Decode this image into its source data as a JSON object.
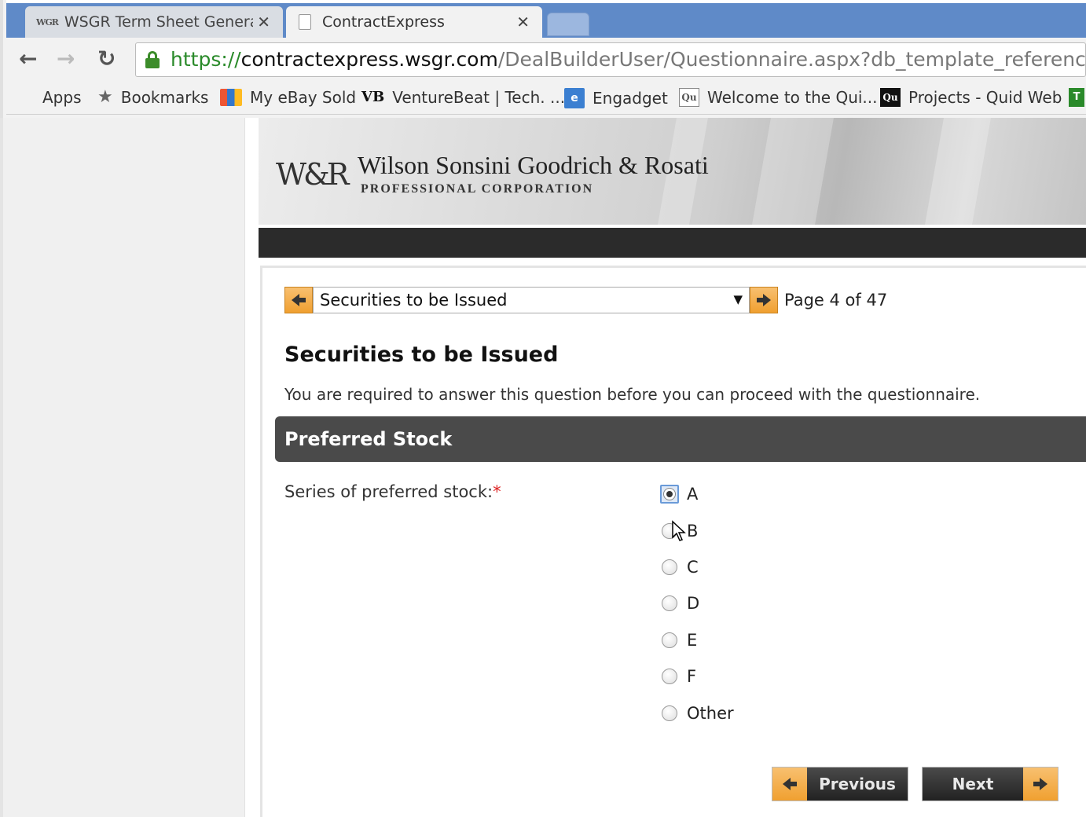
{
  "browser": {
    "tabs": [
      {
        "favicon": "WGR",
        "title": "WSGR Term Sheet Genera",
        "active": false
      },
      {
        "favicon": "document-icon",
        "title": "ContractExpress",
        "active": true
      }
    ],
    "url": {
      "protocol": "https://",
      "host": "contractexpress.wsgr.com",
      "path": "/DealBuilderUser/Questionnaire.aspx?db_template_reference=F"
    },
    "bookmarks": [
      {
        "icon": "apps-grid-icon",
        "label": "Apps"
      },
      {
        "icon": "star-icon",
        "label": "Bookmarks"
      },
      {
        "icon": "ebay-bag-icon",
        "label": "My eBay Sold"
      },
      {
        "icon": "VB",
        "label": "VentureBeat | Tech. ..."
      },
      {
        "icon": "engadget-icon",
        "label": "Engadget"
      },
      {
        "icon": "Qu",
        "label": "Welcome to the Qui..."
      },
      {
        "icon": "Qu",
        "label": "Projects - Quid Web"
      },
      {
        "icon": "T",
        "label": ""
      }
    ]
  },
  "banner": {
    "logo": "W&R",
    "firm_name": "Wilson Sonsini Goodrich & Rosati",
    "firm_subtitle": "PROFESSIONAL CORPORATION"
  },
  "questionnaire": {
    "page_select_value": "Securities to be Issued",
    "page_indicator": "Page 4 of 47",
    "title": "Securities to be Issued",
    "required_notice": "You are required to answer this question before you can proceed with the questionnaire.",
    "section_header": "Preferred Stock",
    "field_label": "Series of preferred stock:",
    "required_marker": "*",
    "options": [
      {
        "label": "A",
        "checked": true
      },
      {
        "label": "B",
        "checked": false
      },
      {
        "label": "C",
        "checked": false
      },
      {
        "label": "D",
        "checked": false
      },
      {
        "label": "E",
        "checked": false
      },
      {
        "label": "F",
        "checked": false
      },
      {
        "label": "Other",
        "checked": false
      }
    ],
    "previous_label": "Previous",
    "next_label": "Next"
  },
  "colors": {
    "accent_orange": "#f0a030",
    "tabbar_blue": "#5f8ac8",
    "section_bar": "#4a4a4a",
    "required_red": "#dd2222"
  }
}
